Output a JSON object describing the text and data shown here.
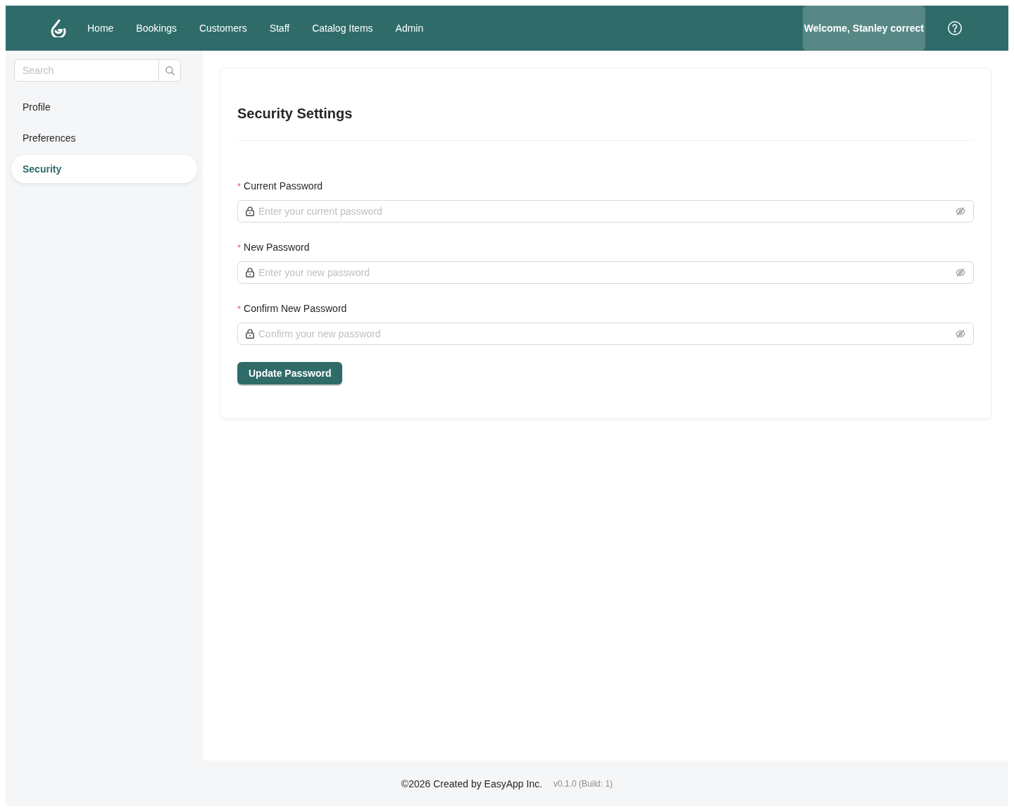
{
  "header": {
    "nav": [
      {
        "label": "Home",
        "selected": false
      },
      {
        "label": "Bookings",
        "selected": false
      },
      {
        "label": "Customers",
        "selected": false
      },
      {
        "label": "Staff",
        "selected": false
      },
      {
        "label": "Catalog Items",
        "selected": false
      },
      {
        "label": "Admin",
        "selected": false
      }
    ],
    "user_menu": {
      "label": "Welcome, Stanley correct",
      "hovered": true
    }
  },
  "sidebar": {
    "search": {
      "placeholder": "Search"
    },
    "items": [
      {
        "label": "Profile",
        "selected": false
      },
      {
        "label": "Preferences",
        "selected": false
      },
      {
        "label": "Security",
        "selected": true
      }
    ]
  },
  "card": {
    "title": "Security Settings",
    "fields": [
      {
        "label": "Current Password",
        "required_mark": "*",
        "placeholder": "Enter your current password",
        "password_visible": false
      },
      {
        "label": "New Password",
        "required_mark": "*",
        "placeholder": "Enter your new password",
        "password_visible": false
      },
      {
        "label": "Confirm New Password",
        "required_mark": "*",
        "placeholder": "Confirm your new password",
        "password_visible": false
      }
    ],
    "button": "Update Password"
  },
  "footer": {
    "copyright": "©2026 Created by EasyApp Inc.",
    "version": "v0.1.0 (Build: 1)"
  }
}
